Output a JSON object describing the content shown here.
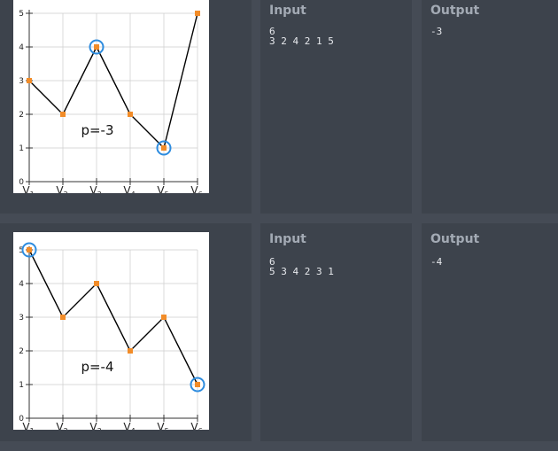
{
  "examples": [
    {
      "input_label": "Input",
      "output_label": "Output",
      "input_lines": [
        "6",
        "3 2 4 2 1 5"
      ],
      "output_value": "-3",
      "chart_data": {
        "type": "line",
        "x": [
          "V1",
          "V2",
          "V3",
          "V4",
          "V5",
          "V6"
        ],
        "values": [
          3,
          2,
          4,
          2,
          1,
          5
        ],
        "highlighted_points": [
          3,
          5
        ],
        "annotation": "p=-3",
        "y_ticks": [
          0,
          1,
          2,
          3,
          4,
          5
        ],
        "ylim": [
          0,
          5
        ],
        "grid": true,
        "colors": {
          "line": "#000000",
          "marker": "#f28c28",
          "highlight": "#2d8cdf",
          "grid": "#cccccc"
        }
      }
    },
    {
      "input_label": "Input",
      "output_label": "Output",
      "input_lines": [
        "6",
        "5 3 4 2 3 1"
      ],
      "output_value": "-4",
      "chart_data": {
        "type": "line",
        "x": [
          "V1",
          "V2",
          "V3",
          "V4",
          "V5",
          "V6"
        ],
        "values": [
          5,
          3,
          4,
          2,
          3,
          1
        ],
        "highlighted_points": [
          1,
          6
        ],
        "annotation": "p=-4",
        "y_ticks": [
          0,
          1,
          2,
          3,
          4,
          5
        ],
        "ylim": [
          0,
          5
        ],
        "grid": true,
        "colors": {
          "line": "#000000",
          "marker": "#f28c28",
          "highlight": "#2d8cdf",
          "grid": "#cccccc"
        }
      }
    }
  ]
}
